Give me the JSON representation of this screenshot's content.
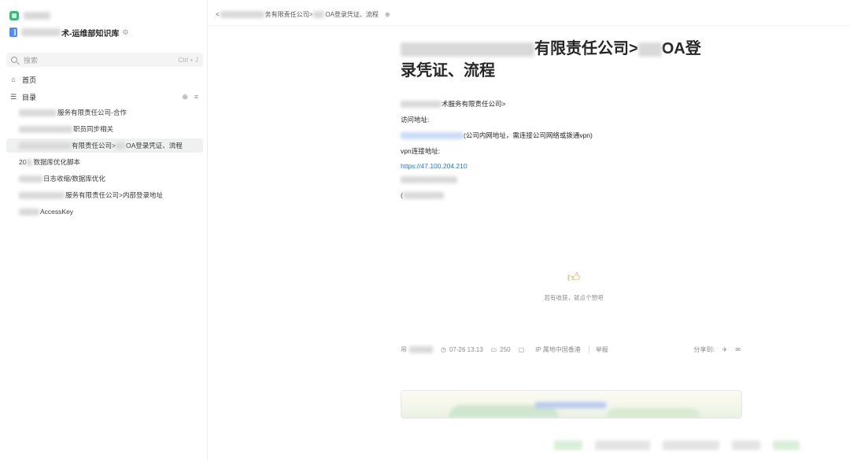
{
  "sidebar": {
    "kb_title_suffix": "术-运维部知识库",
    "search": {
      "placeholder": "搜索",
      "shortcut": "Ctrl + J"
    },
    "home_label": "首页",
    "toc_label": "目录",
    "toc_items": [
      {
        "text": "服务有限责任公司-合作",
        "active": false
      },
      {
        "text": "职员同步相关",
        "active": false
      },
      {
        "text": "有限责任公司>",
        "text2": "OA登录凭证、流程",
        "active": true
      },
      {
        "text": "20",
        "text2": "数据库优化脚本",
        "active": false
      },
      {
        "text": "日志收缩/数据库优化",
        "active": false
      },
      {
        "text": "服务有限责任公司>内部登录地址",
        "active": false
      },
      {
        "text": "AccessKey",
        "active": false
      }
    ]
  },
  "main": {
    "breadcrumb": {
      "prefix": "<",
      "mid": "务有限责任公司>",
      "end": "OA登录凭证、流程"
    },
    "title": {
      "part1": "有限责任公司>",
      "part2": "OA登",
      "part3": "录凭证、流程"
    },
    "body": {
      "line1": "术服务有限责任公司>",
      "access_label": "访问地址:",
      "access_note": "(公司内网地址，需连接公司网络或拨通vpn)",
      "vpn_label": "vpn连接地址:",
      "vpn_link": "https://47.100.204.210",
      "line6": "("
    },
    "like": {
      "text": "若有收获，就点个赞吧"
    },
    "meta": {
      "author_prefix": "吊",
      "date": "07-26 13:13",
      "views": "250",
      "ip": "IP 属地中国香港",
      "report": "举报",
      "share": "分享到:"
    }
  },
  "colors": {
    "link": "#1677ff",
    "like": "#e6a23c",
    "active_bg": "#eff0f0",
    "brand": "#2fbf71"
  }
}
